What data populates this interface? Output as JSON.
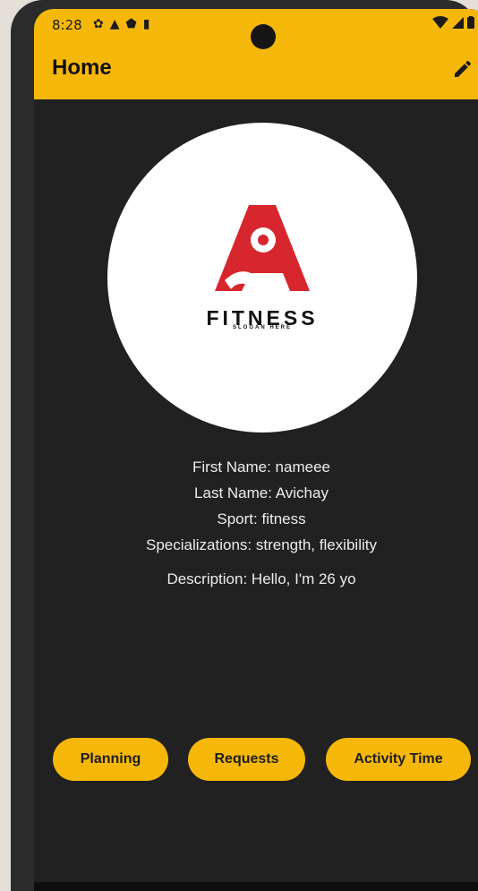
{
  "status_bar": {
    "time": "8:28",
    "left_icons": [
      "gear-icon",
      "warning-icon",
      "shield-icon",
      "sd-card-icon"
    ],
    "right_icons": [
      "wifi-icon",
      "signal-icon",
      "battery-icon"
    ]
  },
  "app_bar": {
    "title": "Home",
    "edit_icon": "pencil-icon",
    "color": "#f5b80a"
  },
  "avatar": {
    "brand": "FITNESS",
    "slogan": "SLOGAN HERE",
    "logo_color": "#d7262e"
  },
  "profile": {
    "first_name": "First Name: nameee",
    "last_name": "Last Name: Avichay",
    "sport": "Sport: fitness",
    "specializations": "Specializations: strength, flexibility",
    "description": "Description: Hello, I'm 26 yo"
  },
  "actions": {
    "planning": "Planning",
    "requests": "Requests",
    "activity_time": "Activity Time"
  }
}
